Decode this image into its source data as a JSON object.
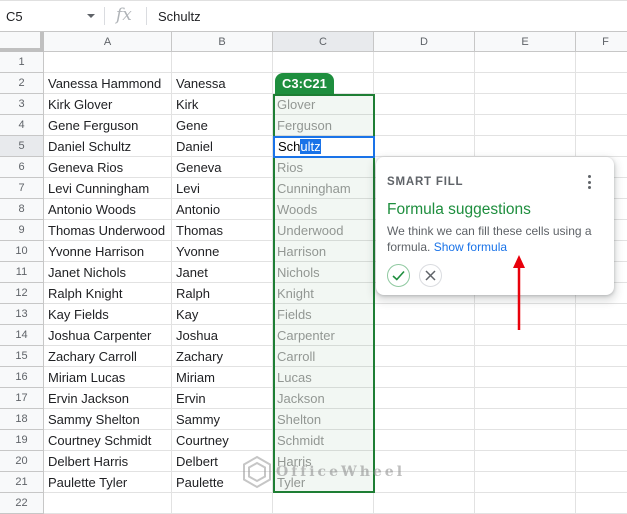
{
  "formula_bar": {
    "name_box": "C5",
    "fx_label": "fx",
    "value": "Schultz"
  },
  "columns": [
    "A",
    "B",
    "C",
    "D",
    "E",
    "F"
  ],
  "rows": [
    {
      "num": "1",
      "a": "",
      "b": "",
      "c": ""
    },
    {
      "num": "2",
      "a": "Vanessa Hammond",
      "b": "Vanessa",
      "c": ""
    },
    {
      "num": "3",
      "a": "Kirk Glover",
      "b": "Kirk",
      "c": "Glover"
    },
    {
      "num": "4",
      "a": "Gene Ferguson",
      "b": "Gene",
      "c": "Ferguson"
    },
    {
      "num": "5",
      "a": "Daniel Schultz",
      "b": "Daniel",
      "c": ""
    },
    {
      "num": "6",
      "a": "Geneva Rios",
      "b": "Geneva",
      "c": "Rios"
    },
    {
      "num": "7",
      "a": "Levi Cunningham",
      "b": "Levi",
      "c": "Cunningham"
    },
    {
      "num": "8",
      "a": "Antonio Woods",
      "b": "Antonio",
      "c": "Woods"
    },
    {
      "num": "9",
      "a": "Thomas Underwood",
      "b": "Thomas",
      "c": "Underwood"
    },
    {
      "num": "10",
      "a": "Yvonne Harrison",
      "b": "Yvonne",
      "c": "Harrison"
    },
    {
      "num": "11",
      "a": "Janet Nichols",
      "b": "Janet",
      "c": "Nichols"
    },
    {
      "num": "12",
      "a": "Ralph Knight",
      "b": "Ralph",
      "c": "Knight"
    },
    {
      "num": "13",
      "a": "Kay Fields",
      "b": "Kay",
      "c": "Fields"
    },
    {
      "num": "14",
      "a": "Joshua Carpenter",
      "b": "Joshua",
      "c": "Carpenter"
    },
    {
      "num": "15",
      "a": "Zachary Carroll",
      "b": "Zachary",
      "c": "Carroll"
    },
    {
      "num": "16",
      "a": "Miriam Lucas",
      "b": "Miriam",
      "c": "Lucas"
    },
    {
      "num": "17",
      "a": "Ervin Jackson",
      "b": "Ervin",
      "c": "Jackson"
    },
    {
      "num": "18",
      "a": "Sammy Shelton",
      "b": "Sammy",
      "c": "Shelton"
    },
    {
      "num": "19",
      "a": "Courtney Schmidt",
      "b": "Courtney",
      "c": "Schmidt"
    },
    {
      "num": "20",
      "a": "Delbert Harris",
      "b": "Delbert",
      "c": "Harris"
    },
    {
      "num": "21",
      "a": "Paulette Tyler",
      "b": "Paulette",
      "c": "Tyler"
    },
    {
      "num": "22",
      "a": "",
      "b": "",
      "c": ""
    }
  ],
  "selection": {
    "range_label": "C3:C21",
    "active_cell_typed": "Sch",
    "active_cell_autocomplete": "ultz"
  },
  "smart_fill": {
    "label": "SMART FILL",
    "title": "Formula suggestions",
    "text": "We think we can fill these cells using a formula.",
    "link": "Show formula",
    "accept_icon": "check-icon",
    "reject_icon": "close-icon",
    "menu_icon": "more-vert-icon"
  },
  "colors": {
    "accent_green": "#1e8e3e",
    "selection_blue": "#1a73e8",
    "annotation_red": "#e8000b"
  },
  "watermark": "OfficeWheel"
}
